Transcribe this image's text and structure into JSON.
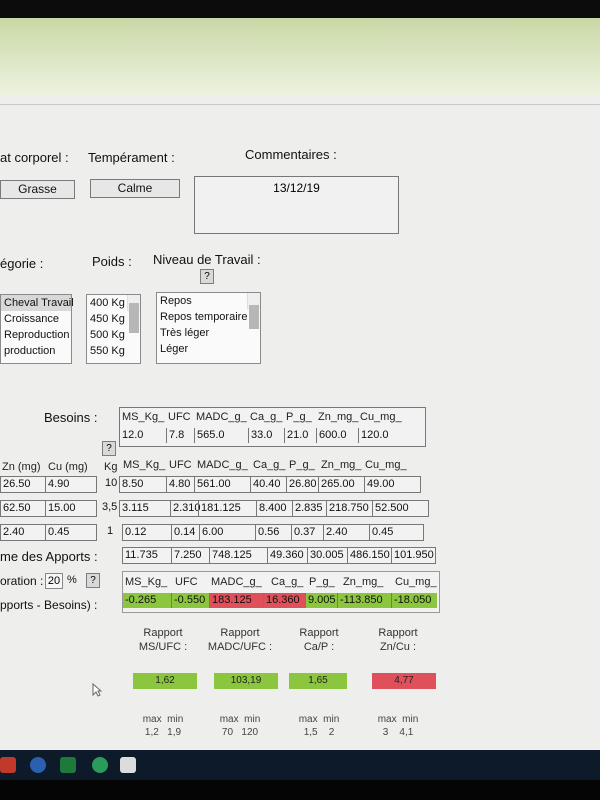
{
  "header": {
    "etat_label": "at corporel :",
    "temperament_label": "Tempérament :",
    "commentaires_label": "Commentaires :"
  },
  "fields": {
    "etat_value": "Grasse",
    "temperament_value": "Calme",
    "commentaire_value": "13/12/19"
  },
  "labels": {
    "categorie": "égorie :",
    "poids": "Poids :",
    "niveau_travail": "Niveau de Travail :",
    "help": "?"
  },
  "categorie_list": [
    "Cheval Travail",
    "Croissance",
    "Reproduction",
    "production"
  ],
  "poids_list": [
    "400 Kg",
    "450 Kg",
    "500 Kg",
    "550 Kg"
  ],
  "travail_list": [
    "Repos",
    "Repos temporaire",
    "Très léger",
    "Léger"
  ],
  "besoins": {
    "label": "Besoins :",
    "headers": [
      "MS_Kg_",
      "UFC",
      "MADC_g_",
      "Ca_g_",
      "P_g_",
      "Zn_mg_",
      "Cu_mg_"
    ],
    "values": [
      "12.0",
      "7.8",
      "565.0",
      "33.0",
      "21.0",
      "600.0",
      "120.0"
    ]
  },
  "apports": {
    "left_headers": [
      "Zn (mg)",
      "Cu (mg)"
    ],
    "kg_header": "Kg",
    "headers": [
      "MS_Kg_",
      "UFC",
      "MADC_g_",
      "Ca_g_",
      "P_g_",
      "Zn_mg_",
      "Cu_mg_"
    ],
    "rows": [
      {
        "zn": "26.50",
        "cu": "4.90",
        "kg": "10",
        "vals": [
          "8.50",
          "4.80",
          "561.00",
          "40.40",
          "26.80",
          "265.00",
          "49.00"
        ]
      },
      {
        "zn": "62.50",
        "cu": "15.00",
        "kg": "3,5",
        "vals": [
          "3.115",
          "2.310",
          "181.125",
          "8.400",
          "2.835",
          "218.750",
          "52.500"
        ]
      },
      {
        "zn": "2.40",
        "cu": "0.45",
        "kg": "1",
        "vals": [
          "0.12",
          "0.14",
          "6.00",
          "0.56",
          "0.37",
          "2.40",
          "0.45"
        ]
      }
    ]
  },
  "somme": {
    "label": "me des Apports :",
    "values": [
      "11.735",
      "7.250",
      "748.125",
      "49.360",
      "30.005",
      "486.150",
      "101.950"
    ]
  },
  "evaporation": {
    "label": "oration :",
    "value": "20",
    "unit": "%"
  },
  "diff": {
    "label": "pports - Besoins) :",
    "headers": [
      "MS_Kg_",
      "UFC",
      "MADC_g_",
      "Ca_g_",
      "P_g_",
      "Zn_mg_",
      "Cu_mg_"
    ],
    "values": [
      "-0.265",
      "-0.550",
      "183.125",
      "16.360",
      "9.005",
      "-113.850",
      "-18.050"
    ],
    "status": [
      "ok",
      "ok",
      "bad",
      "bad",
      "ok",
      "ok",
      "ok"
    ]
  },
  "ratios": [
    {
      "line1": "Rapport",
      "line2": "MS/UFC :",
      "value": "1,62",
      "status": "ok",
      "max": "1,2",
      "min": "1,9"
    },
    {
      "line1": "Rapport",
      "line2": "MADC/UFC :",
      "value": "103,19",
      "status": "ok",
      "max": "70",
      "min": "120"
    },
    {
      "line1": "Rapport",
      "line2": "Ca/P :",
      "value": "1,65",
      "status": "ok",
      "max": "1,5",
      "min": "2"
    },
    {
      "line1": "Rapport",
      "line2": "Zn/Cu :",
      "value": "4,77",
      "status": "bad",
      "max": "3",
      "min": "4,1"
    }
  ],
  "minmax_labels": {
    "max": "max",
    "min": "min"
  },
  "colors": {
    "ok": "#8cc63f",
    "bad": "#e0505a"
  }
}
